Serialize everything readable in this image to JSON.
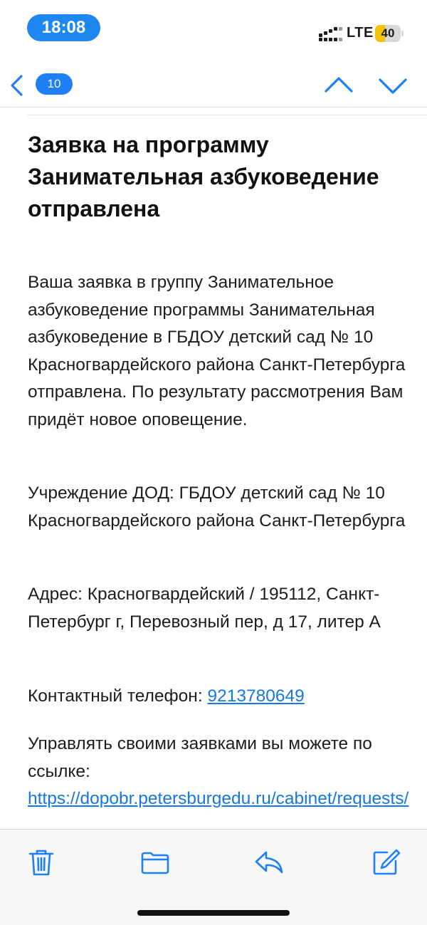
{
  "status_bar": {
    "time": "18:08",
    "network": "LTE",
    "battery_level": "40",
    "battery_fraction": 0.4,
    "battery_color": "#f5c400"
  },
  "nav": {
    "back_icon": "chevron-left-icon",
    "unread_count": "10",
    "prev_icon": "chevron-up-icon",
    "next_icon": "chevron-down-icon",
    "accent": "#1f7ff5"
  },
  "email": {
    "subject": "Заявка на программу Занимательная азбуковедение отправлена",
    "body_1": "Ваша заявка в группу Занимательное азбуковедение программы Занимательная азбуковедение в ГБДОУ детский сад № 10 Красногвардейского района Санкт-Петербурга отправлена. По результату рассмотрения Вам придёт новое оповещение.",
    "body_2": "Учреждение ДОД: ГБДОУ детский сад № 10 Красногвардейского района Санкт-Петербурга",
    "body_3": "Адрес: Красногвардейский / 195112, Санкт-Петербург г, Перевозный пер, д 17, литер А",
    "phone_label": "Контактный телефон: ",
    "phone": "9213780649",
    "manage_label": "Управлять своими заявками вы можете по ссылке: ",
    "manage_link": "https://dopobr.petersburgedu.ru/cabinet/requests/"
  },
  "toolbar": {
    "icons": [
      "trash-icon",
      "folder-icon",
      "reply-icon",
      "compose-icon"
    ]
  }
}
